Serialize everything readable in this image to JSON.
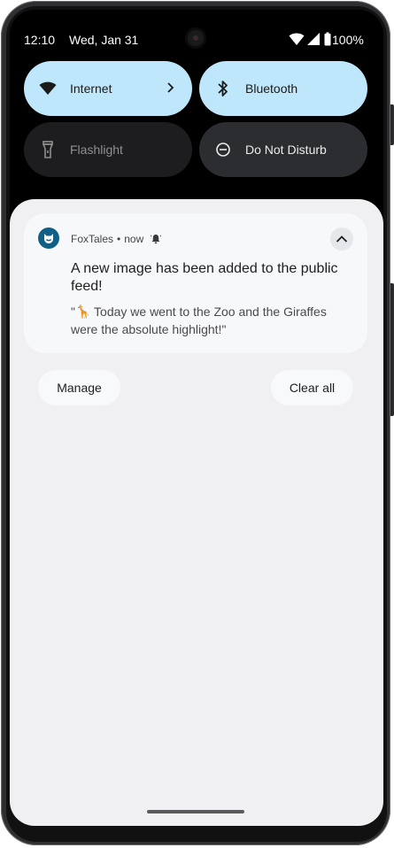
{
  "status_bar": {
    "time": "12:10",
    "date": "Wed, Jan 31",
    "battery": "100%"
  },
  "quick_tiles": [
    {
      "label": "Internet",
      "icon": "wifi-icon",
      "state": "on"
    },
    {
      "label": "Bluetooth",
      "icon": "bluetooth-icon",
      "state": "on"
    },
    {
      "label": "Flashlight",
      "icon": "flashlight-icon",
      "state": "off"
    },
    {
      "label": "Do Not Disturb",
      "icon": "do-not-disturb-icon",
      "state": "off"
    }
  ],
  "notification": {
    "app_name": "FoxTales",
    "separator": "•",
    "time": "now",
    "title": "A new image has been added to the public feed!",
    "body": "\"🦒 Today we went to the Zoo and the Giraffes were the absolute highlight!\""
  },
  "actions": {
    "manage_label": "Manage",
    "clear_all_label": "Clear all"
  },
  "colors": {
    "tile_active": "#bfe7fb",
    "app_icon": "#0f5f86",
    "shade_background": "#f0f0f2"
  }
}
